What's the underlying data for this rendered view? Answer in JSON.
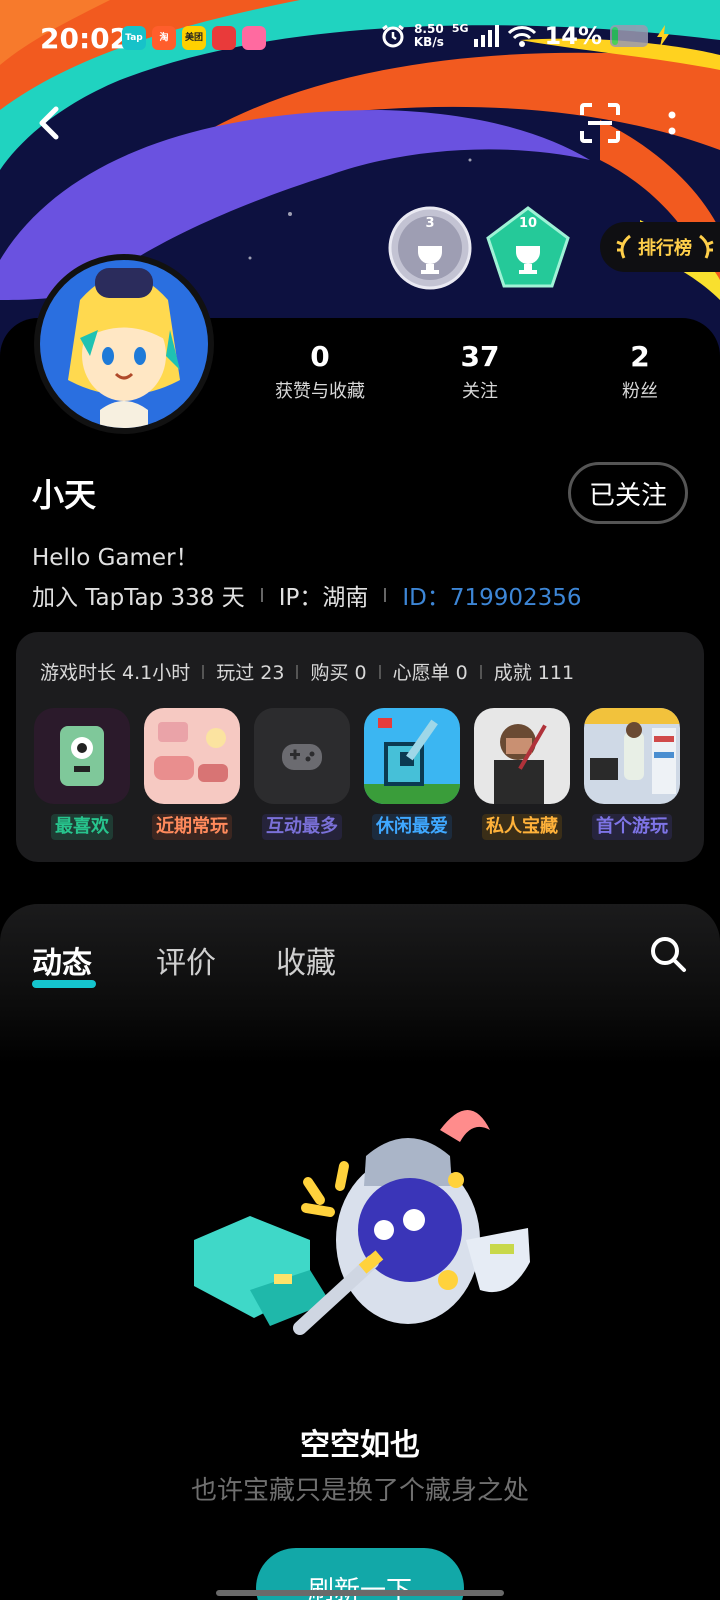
{
  "status_bar": {
    "time": "20:02",
    "net_speed_value": "8.50",
    "net_speed_unit": "KB/s",
    "network": "5G",
    "battery": "14%",
    "notification_apps": [
      "Tap",
      "淘",
      "美团",
      "",
      ""
    ]
  },
  "nav": {
    "back_icon": "chevron-left-icon",
    "scan_icon": "scan-icon",
    "more_icon": "more-vertical-icon"
  },
  "badges": [
    {
      "number": "3",
      "color": "#b7b7c6"
    },
    {
      "number": "10",
      "color": "#1fbf8a"
    }
  ],
  "leaderboard_label": "排行榜",
  "profile": {
    "name": "小天",
    "follow_label": "已关注",
    "bio": "Hello Gamer！",
    "joined": "加入 TapTap 338 天",
    "ip": "IP：湖南",
    "id": "ID：719902356"
  },
  "stats": [
    {
      "value": "0",
      "label": "获赞与收藏"
    },
    {
      "value": "37",
      "label": "关注"
    },
    {
      "value": "2",
      "label": "粉丝"
    }
  ],
  "game_summary": [
    "游戏时长 4.1小时",
    "玩过 23",
    "购买 0",
    "心愿单 0",
    "成就 111"
  ],
  "games": [
    {
      "tag": "最喜欢",
      "color": "#27c48d",
      "bg": "#1f3b33"
    },
    {
      "tag": "近期常玩",
      "color": "#ff8a5c",
      "bg": "#3b2620"
    },
    {
      "tag": "互动最多",
      "color": "#7a70d8",
      "bg": "#25233a"
    },
    {
      "tag": "休闲最爱",
      "color": "#3fa8ff",
      "bg": "#1c2b3d"
    },
    {
      "tag": "私人宝藏",
      "color": "#ffb23a",
      "bg": "#3a2e18"
    },
    {
      "tag": "首个游玩",
      "color": "#7e74e6",
      "bg": "#26243d"
    }
  ],
  "tabs": [
    {
      "label": "动态",
      "active": true
    },
    {
      "label": "评价",
      "active": false
    },
    {
      "label": "收藏",
      "active": false
    }
  ],
  "empty_state": {
    "title": "空空如也",
    "subtitle": "也许宝藏只是换了个藏身之处",
    "button": "刷新一下"
  },
  "colors": {
    "accent": "#15c5ce",
    "id_link": "#3d86d6",
    "rank_gold": "#ffcf4a"
  }
}
